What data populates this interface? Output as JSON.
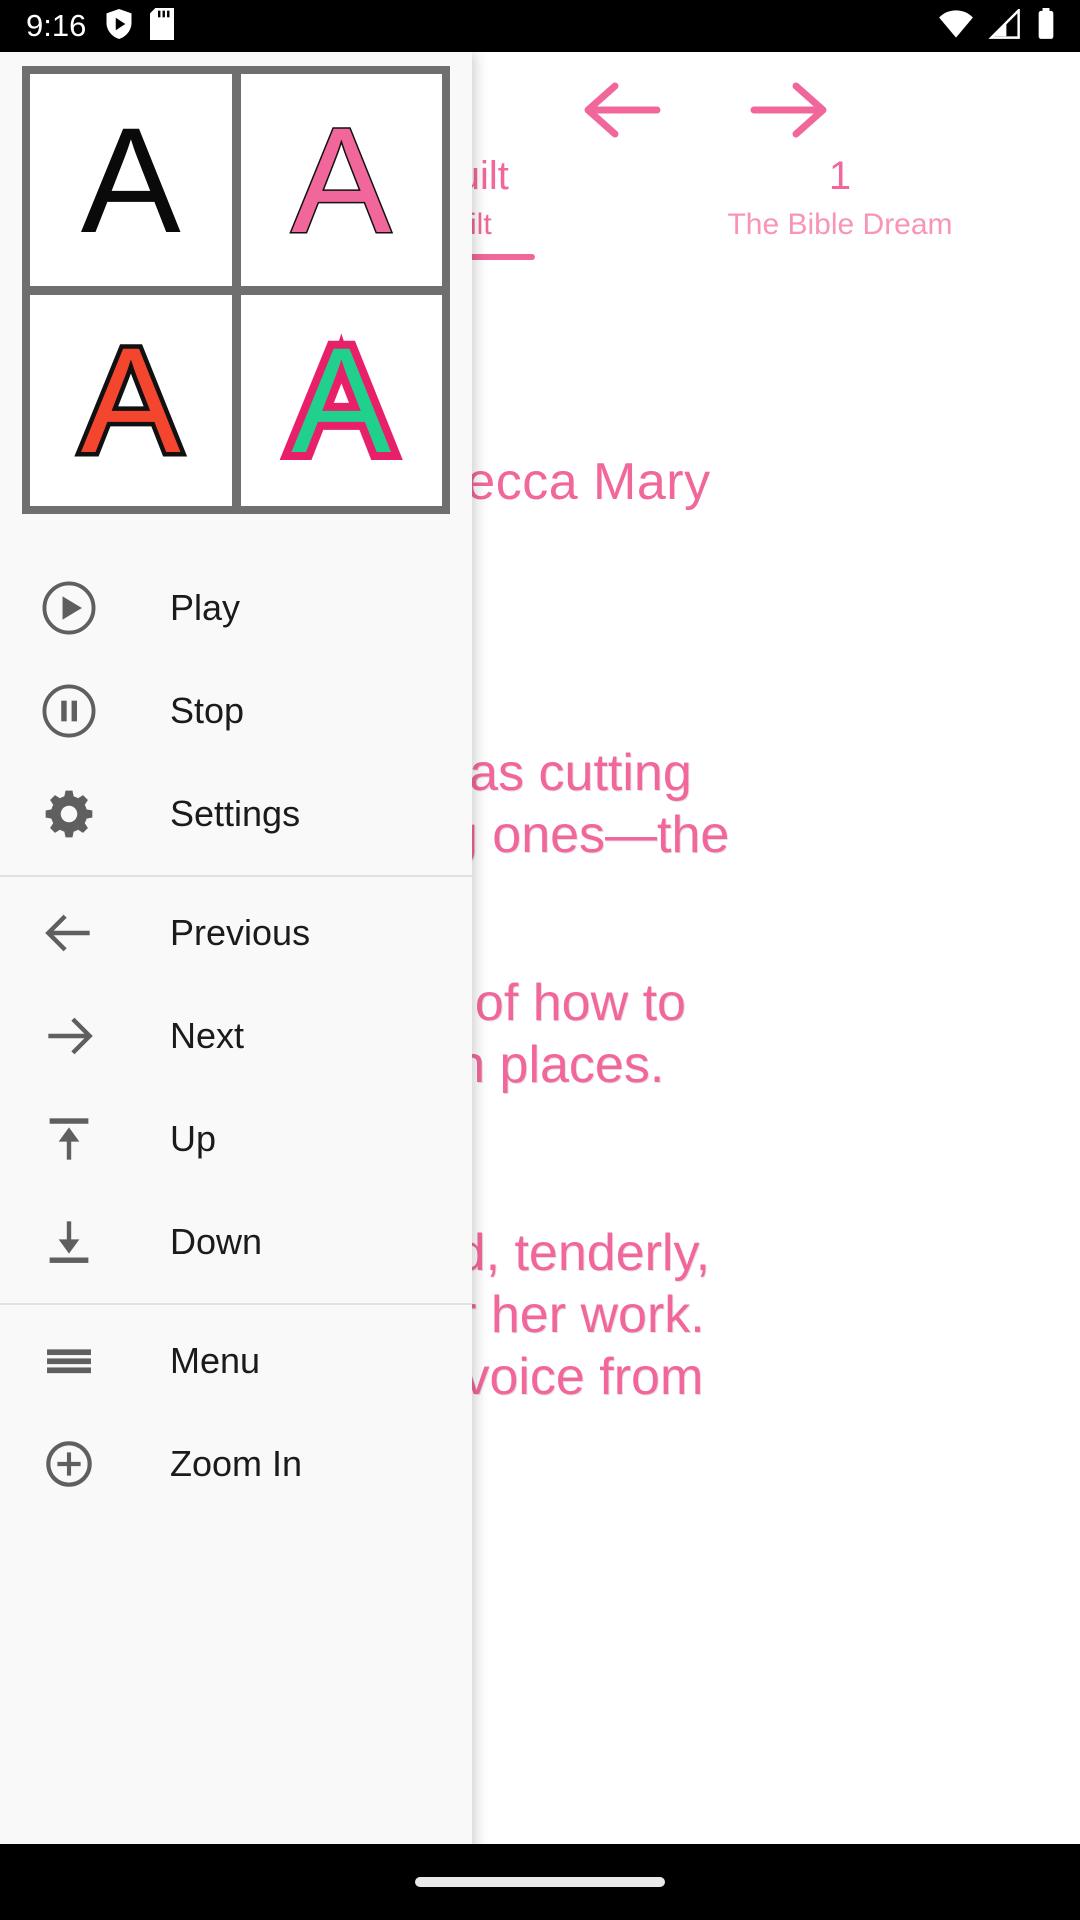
{
  "status_bar": {
    "time": "9:16",
    "left_icons": [
      "shield-play-icon",
      "sd-card-icon"
    ],
    "right_icons": [
      "wifi-icon",
      "signal-icon",
      "battery-icon"
    ],
    "background_color": "#000000",
    "foreground_color": "#ffffff"
  },
  "reader": {
    "accent_color": "#f2679b",
    "prev_chapter": {
      "title": "nd Quilt",
      "subtitle": "nd Quilt"
    },
    "next_chapter": {
      "number": "1",
      "title": "The Bible Dream"
    },
    "byline": "Rebecca Mary",
    "paragraphs": [
      "e was cutting\nof big ones—the",
      "zle of how to\nnin places.",
      "ghed, tenderly,\nover her work.\nthe voice from"
    ]
  },
  "drawer": {
    "background_color": "#f9f9f9",
    "font_styles": [
      {
        "name": "plain-black",
        "glyph": "A",
        "fill": "#0a0a0a",
        "outline": "none"
      },
      {
        "name": "pink-outlined",
        "glyph": "A",
        "fill": "#f2679b",
        "outline": "#111111"
      },
      {
        "name": "red-heavy-outline",
        "glyph": "A",
        "fill": "#f4452e",
        "outline": "#111111"
      },
      {
        "name": "green-pink-outline",
        "glyph": "A",
        "fill": "#1fd18c",
        "outline": "#e8206a"
      }
    ],
    "groups": [
      {
        "name": "playback",
        "items": [
          {
            "label": "Play",
            "icon": "play-circle-icon"
          },
          {
            "label": "Stop",
            "icon": "pause-circle-icon"
          },
          {
            "label": "Settings",
            "icon": "gear-icon"
          }
        ]
      },
      {
        "name": "navigation",
        "items": [
          {
            "label": "Previous",
            "icon": "arrow-left-icon"
          },
          {
            "label": "Next",
            "icon": "arrow-right-icon"
          },
          {
            "label": "Up",
            "icon": "vertical-align-top-icon"
          },
          {
            "label": "Down",
            "icon": "vertical-align-bottom-icon"
          }
        ]
      },
      {
        "name": "tools",
        "items": [
          {
            "label": "Menu",
            "icon": "hamburger-menu-icon"
          },
          {
            "label": "Zoom In",
            "icon": "zoom-in-circle-icon"
          }
        ]
      }
    ]
  },
  "nav_bar": {
    "gesture_pill": "home-gesture-pill"
  }
}
